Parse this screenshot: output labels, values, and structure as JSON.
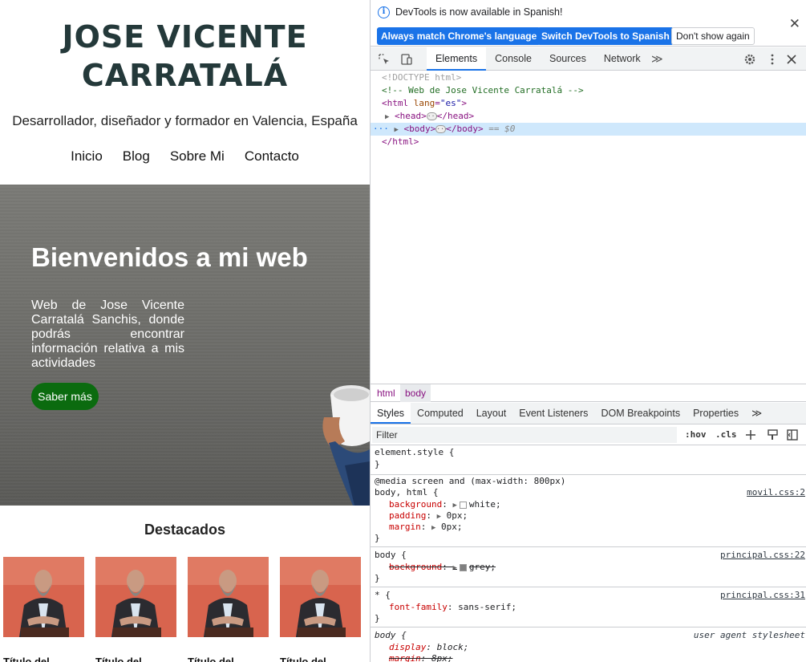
{
  "site": {
    "title_line1": "JOSE VICENTE",
    "title_line2": "CARRATALÁ",
    "tagline": "Desarrollador, diseñador y formador en Valencia, España",
    "nav": [
      "Inicio",
      "Blog",
      "Sobre Mi",
      "Contacto"
    ],
    "hero": {
      "heading": "Bienvenidos a mi web",
      "text": "Web de Jose Vicente Carratalá Sanchis, donde podrás encontrar información relativa a mis actividades",
      "button": "Saber más"
    },
    "featured_heading": "Destacados",
    "card_title": "Título del..."
  },
  "devtools": {
    "infobar": {
      "message": "DevTools is now available in Spanish!",
      "btn_match": "Always match Chrome's language",
      "btn_switch": "Switch DevTools to Spanish",
      "btn_dont": "Don't show again",
      "close": "✕"
    },
    "tabs": [
      "Elements",
      "Console",
      "Sources",
      "Network"
    ],
    "more_tabs": "≫",
    "dom": {
      "doctype": "<!DOCTYPE html>",
      "comment": "<!-- Web de Jose Vicente Carratalá -->",
      "html_open_tag": "<html",
      "html_attr": "lang",
      "html_attr_val": "\"es\"",
      "head_open": "<head>",
      "head_close": "</head>",
      "body_open": "<body>",
      "body_close": "</body>",
      "body_marker": "== $0",
      "html_close": "</html>"
    },
    "breadcrumbs": [
      "html",
      "body"
    ],
    "subtabs": [
      "Styles",
      "Computed",
      "Layout",
      "Event Listeners",
      "DOM Breakpoints",
      "Properties"
    ],
    "filter_placeholder": "Filter",
    "filter_tools": [
      ":hov",
      ".cls"
    ],
    "styles": {
      "element_style": "element.style {",
      "close_brace": "}",
      "media": "@media screen and (max-width: 800px)",
      "r1_selector": "body, html {",
      "r1_source": "movil.css:2",
      "r1_props": [
        {
          "name": "background",
          "value": "white;"
        },
        {
          "name": "padding",
          "value": "0px;"
        },
        {
          "name": "margin",
          "value": "0px;"
        }
      ],
      "r2_selector": "body {",
      "r2_source": "principal.css:22",
      "r2_prop": {
        "name": "background",
        "value": "grey;"
      },
      "r3_selector": "* {",
      "r3_source": "principal.css:31",
      "r3_prop": {
        "name": "font-family",
        "value": "sans-serif;"
      },
      "r4_selector": "body {",
      "r4_source": "user agent stylesheet",
      "r4_props": [
        {
          "name": "display",
          "value": "block;"
        },
        {
          "name": "margin",
          "value": "8px;"
        }
      ]
    },
    "colors": {
      "accent": "#1a73e8",
      "swatch_white": "#ffffff",
      "swatch_grey": "#808080"
    }
  }
}
